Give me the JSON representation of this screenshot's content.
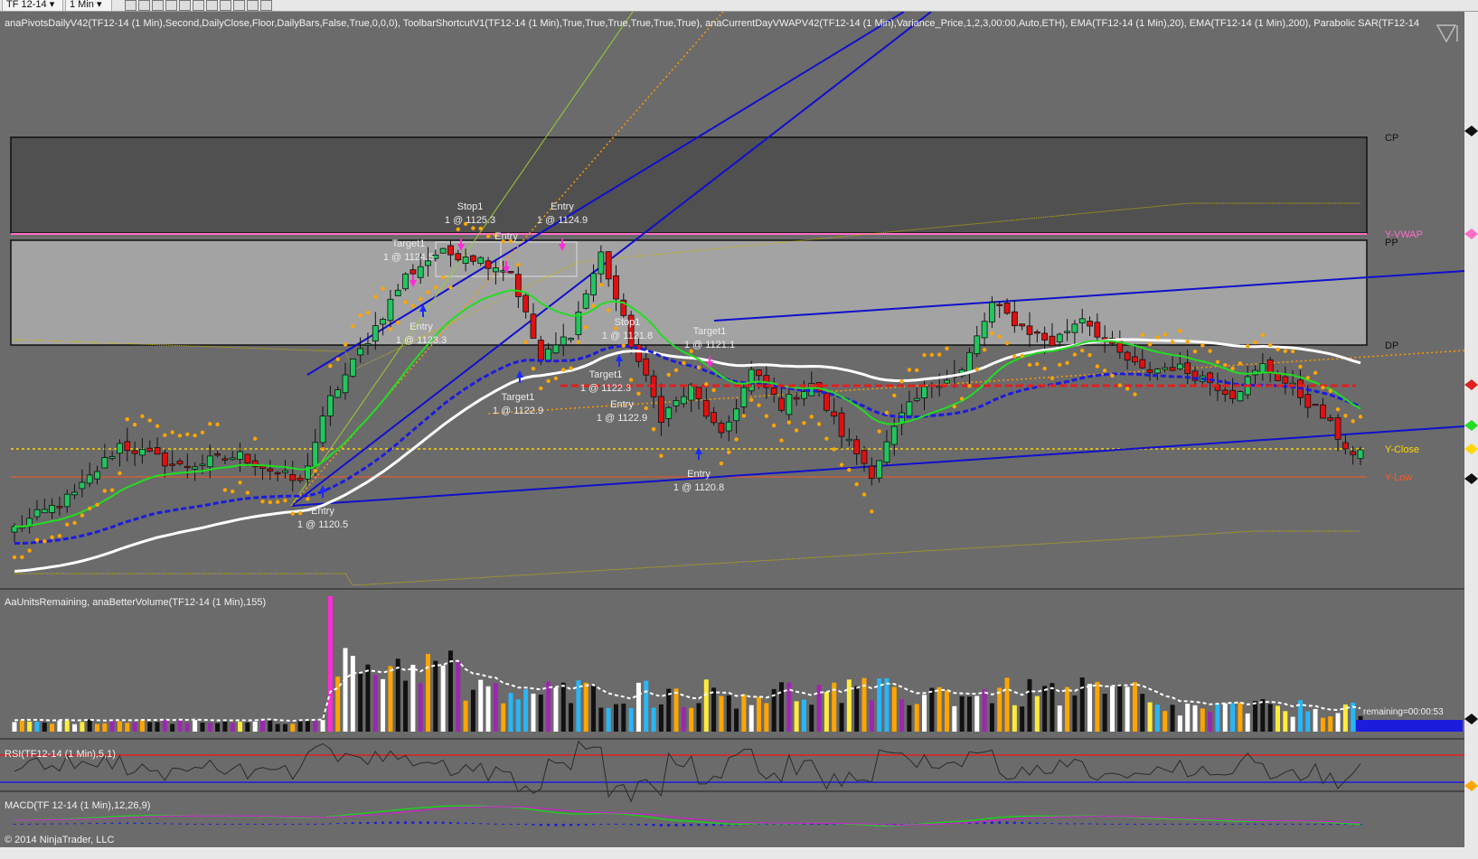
{
  "toolbar": {
    "instrument": "TF 12-14",
    "interval": "1 Min",
    "icons": [
      "bar-type-icon",
      "draw-icon",
      "zoom-in-icon",
      "zoom-out-icon",
      "crosshair-icon",
      "data-box-icon",
      "chart-trader-icon",
      "indicators-icon",
      "strategies-icon",
      "properties-icon",
      "save-icon"
    ]
  },
  "panels": {
    "price_title": "anaPivotsDailyV42(TF12-14 (1 Min),Second,DailyClose,Floor,DailyBars,False,True,0,0,0), ToolbarShortcutV1(TF12-14 (1 Min),True,True,True,True,True,True), anaCurrentDayVWAPV42(TF12-14 (1 Min),Variance_Price,1,2,3,00:00,Auto,ETH), EMA(TF12-14 (1 Min),20), EMA(TF12-14 (1 Min),200), Parabolic SAR(TF12-14",
    "volume_title": "AaUnitsRemaining, anaBetterVolume(TF12-14 (1 Min),155)",
    "units_remaining": "remaining=00:00:53",
    "rsi_title": "RSI(TF12-14 (1 Min),5,1)",
    "macd_title": "MACD(TF 12-14 (1 Min),12,26,9)",
    "copyright": "© 2014 NinjaTrader, LLC"
  },
  "levels": [
    {
      "label": "CP",
      "color": "#111111"
    },
    {
      "label": "Y-VWAP",
      "color": "#ff6ec7"
    },
    {
      "label": "PP",
      "color": "#111111"
    },
    {
      "label": "DP",
      "color": "#111111"
    },
    {
      "label": "Y-Close",
      "color": "#ffd700"
    },
    {
      "label": "Y-Low",
      "color": "#ff5a1f"
    }
  ],
  "annotations": [
    {
      "title": "Stop1",
      "detail": "1 @ 1125.3"
    },
    {
      "title": "Entry",
      "detail": "1 @ 1124.9"
    },
    {
      "title": "Entry",
      "detail": ""
    },
    {
      "title": "Target1",
      "detail": "1 @ 1124.5"
    },
    {
      "title": "Entry",
      "detail": "1 @ 1123.3"
    },
    {
      "title": "Stop1",
      "detail": "1 @ 1121.8"
    },
    {
      "title": "Target1",
      "detail": "1 @ 1121.1"
    },
    {
      "title": "Target1",
      "detail": "1 @ 1122.3"
    },
    {
      "title": "Target1",
      "detail": "1 @ 1122.9"
    },
    {
      "title": "Entry",
      "detail": "1 @ 1122.9"
    },
    {
      "title": "Entry",
      "detail": "1 @ 1120.8"
    },
    {
      "title": "Entry",
      "detail": "1 @ 1120.5"
    }
  ],
  "colors": {
    "background": "#6b6b6b",
    "up_candle": "#22c55e",
    "down_candle": "#e01010",
    "ema20": "#22dd22",
    "ema200": "#ffffff",
    "parabolic_sar": "#ffa500",
    "trendline": "#1010cc",
    "vwap_band": "#c8b400",
    "rsi_line": "#2a2a2a",
    "macd_line": "#22cc22",
    "macd_signal": "#cc22cc"
  },
  "chart_data": {
    "type": "candlestick",
    "instrument": "TF 12-14",
    "interval": "1 Min",
    "candles_shown": 180,
    "price_path": [
      [
        0,
        1120.0
      ],
      [
        8,
        1120.6
      ],
      [
        14,
        1121.5
      ],
      [
        22,
        1121.1
      ],
      [
        30,
        1121.3
      ],
      [
        38,
        1120.8
      ],
      [
        42,
        1122.3
      ],
      [
        48,
        1123.6
      ],
      [
        52,
        1124.5
      ],
      [
        56,
        1124.9
      ],
      [
        60,
        1124.9
      ],
      [
        66,
        1124.6
      ],
      [
        70,
        1123.0
      ],
      [
        74,
        1123.5
      ],
      [
        78,
        1124.9
      ],
      [
        82,
        1123.3
      ],
      [
        86,
        1122.0
      ],
      [
        90,
        1122.5
      ],
      [
        94,
        1121.6
      ],
      [
        98,
        1122.8
      ],
      [
        102,
        1122.2
      ],
      [
        106,
        1122.6
      ],
      [
        110,
        1121.7
      ],
      [
        114,
        1121.0
      ],
      [
        118,
        1122.0
      ],
      [
        122,
        1122.6
      ],
      [
        126,
        1122.8
      ],
      [
        130,
        1124.0
      ],
      [
        134,
        1123.6
      ],
      [
        138,
        1123.3
      ],
      [
        142,
        1123.8
      ],
      [
        146,
        1123.2
      ],
      [
        150,
        1122.8
      ],
      [
        154,
        1122.9
      ],
      [
        158,
        1122.7
      ],
      [
        162,
        1122.4
      ],
      [
        166,
        1122.9
      ],
      [
        170,
        1122.5
      ],
      [
        174,
        1122.0
      ],
      [
        178,
        1121.3
      ]
    ],
    "rsi_levels": [
      70,
      30
    ]
  }
}
